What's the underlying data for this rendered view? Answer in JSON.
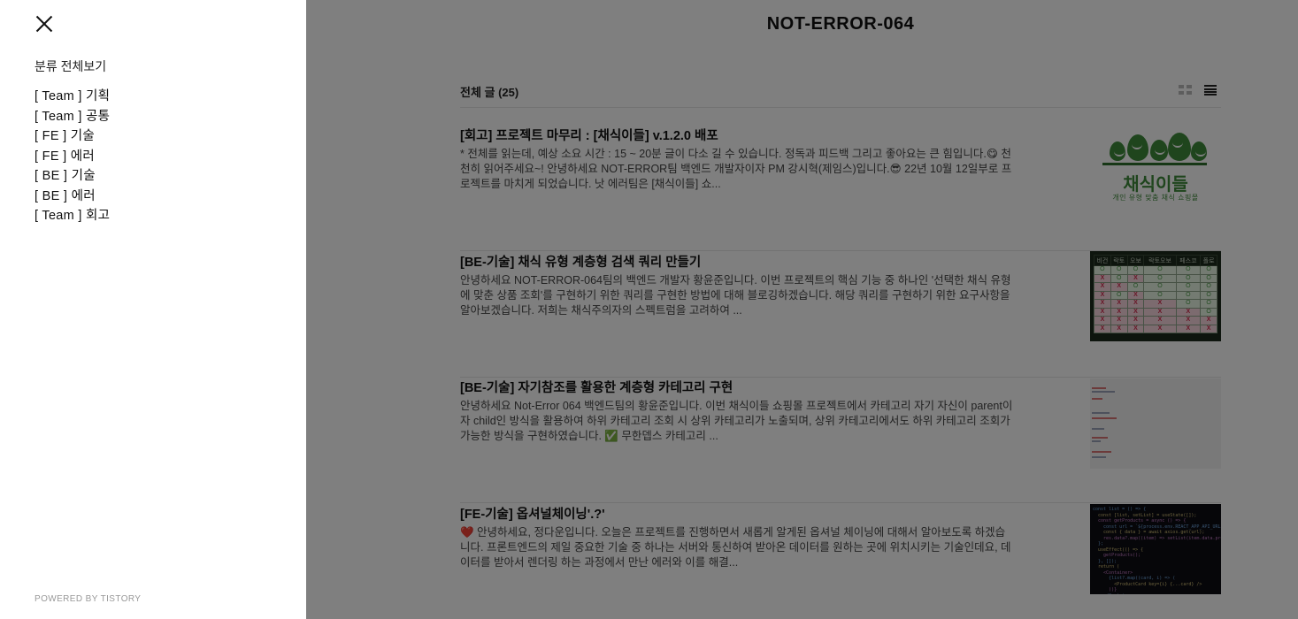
{
  "sidebar": {
    "category_all": "분류 전체보기",
    "categories": [
      {
        "label": "[ Team ] 기획"
      },
      {
        "label": "[ Team ] 공통"
      },
      {
        "label": "[ FE ] 기술"
      },
      {
        "label": "[ FE ] 에러"
      },
      {
        "label": "[ BE ] 기술"
      },
      {
        "label": "[ BE ] 에러"
      },
      {
        "label": "[ Team ] 회고"
      }
    ],
    "powered_by": "POWERED BY TISTORY"
  },
  "blog": {
    "title": "NOT-ERROR-064",
    "list_count": "전체 글 (25)",
    "posts": [
      {
        "title": "[회고] 프로젝트 마무리 : [채식이들] v.1.2.0 배포",
        "excerpt": "* 전체를 읽는데, 예상 소요 시간 : 15 ~ 20분 글이 다소 길 수 있습니다. 정독과 피드백 그리고 좋아요는 큰 힘입니다.😋 천천히 읽어주세요~! 안녕하세요 NOT-ERROR팀 백엔드 개발자이자 PM 강시혁(제임스)입니다.😎 22년 10월 12일부로 프로젝트를 마치게 되었습니다. 낫 에러팀은 [채식이들] 쇼...",
        "thumb": {
          "logo_name": "채식이들",
          "logo_sub": "개인 유형 맞춤 채식 쇼핑몰"
        }
      },
      {
        "title": "[BE-기술] 채식 유형 계층형 검색 쿼리 만들기",
        "excerpt": "안녕하세요 NOT-ERROR-064팀의 백엔드 개발자 황윤준입니다. 이번 프로젝트의 핵심 기능 중 하나인 '선택한 채식 유형에 맞춘 상품 조회'를 구현하기 위한 쿼리를 구현한 방법에 대해 블로깅하겠습니다. 해당 쿼리를 구현하기 위한 요구사항을 알아보겠습니다. 저희는 채식주의자의 스펙트럼을 고려하여 ...",
        "thumb": {
          "headers": [
            "비건",
            "락토",
            "오보",
            "락토오보",
            "페스코",
            "폴로"
          ],
          "rows": [
            [
              "O",
              "O",
              "O",
              "O",
              "O",
              "O"
            ],
            [
              "X",
              "O",
              "X",
              "O",
              "O",
              "O"
            ],
            [
              "X",
              "X",
              "O",
              "O",
              "O",
              "O"
            ],
            [
              "X",
              "O",
              "X",
              "O",
              "O",
              "O"
            ],
            [
              "X",
              "X",
              "X",
              "X",
              "O",
              "O"
            ],
            [
              "X",
              "X",
              "X",
              "X",
              "X",
              "O"
            ],
            [
              "X",
              "X",
              "X",
              "X",
              "X",
              "X"
            ],
            [
              "X",
              "X",
              "X",
              "X",
              "X",
              "X"
            ]
          ]
        }
      },
      {
        "title": "[BE-기술] 자기참조를 활용한 계층형 카테고리 구현",
        "excerpt": "안녕하세요 Not-Error 064 백엔드팀의 황윤준입니다. 이번 채식이들 쇼핑몰 프로젝트에서 카테고리 자기 자신이 parent이자 child인 방식을 활용하여 하위 카테고리 조회 시 상위 카테고리가 노출되며, 상위 카테고리에서도 하위 카테고리 조회가 가능한 방식을 구현하였습니다. ✅ 무한뎁스 카테고리 ..."
      },
      {
        "title": "[FE-기술] 옵셔널체이닝'.?'",
        "excerpt": "❤️ 안녕하세요, 정다운입니다. 오늘은 프로젝트를 진행하면서 새롭게 알게된 옵셔널 체이닝에 대해서 알아보도록 하겠습니다. 프론트엔드의 제일 중요한 기술 중 하나는 서버와 통신하여 받아온 데이터를 원하는 곳에 위치시키는 기술인데요, 데이터를 받아서 렌더링 하는 과정에서 만난 에러와 이를 해결...",
        "thumb": {
          "lines": [
            "const list = () => {",
            "  const [list, setList] = useState([]);",
            "  const getProducts = async () => {",
            "    const url = `${process.env.REACT_APP_API_URL}/products`;",
            "    const { data } = await axios.get(url);",
            "    res.data?.map((item) => setList(item.data.product));",
            "  };",
            "  useEffect(() => {",
            "    getProducts();",
            "  }, []);",
            "  return (",
            "    <Container>",
            "      {list?.map((card, i) => (",
            "        <ProductCard key={i} {...card} />",
            "      ))}",
            "    </Container>",
            "  );",
            "};"
          ]
        }
      }
    ]
  },
  "colors": {
    "overlay": "rgba(0,0,0,0.5)",
    "logo_green": "#3f8a3b",
    "table_x": "#d22c4e",
    "table_o": "#4b9a47"
  }
}
